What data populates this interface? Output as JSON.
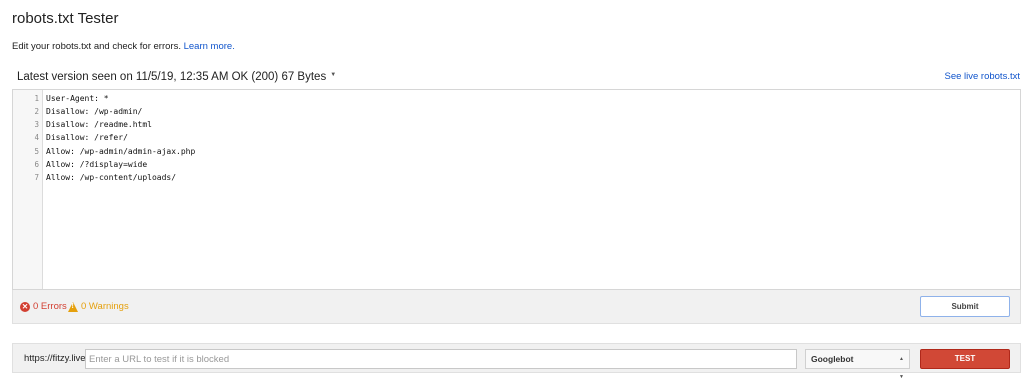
{
  "header": {
    "title": "robots.txt Tester",
    "description": "Edit your robots.txt and check for errors.",
    "learn_more": "Learn more."
  },
  "version": {
    "text": "Latest version seen on 11/5/19, 12:35 AM OK (200) 67 Bytes",
    "see_live": "See live robots.txt"
  },
  "editor": {
    "line_numbers": [
      "1",
      "2",
      "3",
      "4",
      "5",
      "6",
      "7"
    ],
    "lines": [
      "User-Agent: *",
      "Disallow: /wp-admin/",
      "Disallow: /readme.html",
      "Disallow: /refer/",
      "Allow: /wp-admin/admin-ajax.php",
      "Allow: /?display=wide",
      "Allow: /wp-content/uploads/"
    ]
  },
  "status": {
    "errors": "0 Errors",
    "warnings": "0 Warnings",
    "submit_label": "Submit"
  },
  "test": {
    "url_prefix": "https://fitzy.live/",
    "url_placeholder": "Enter a URL to test if it is blocked",
    "user_agent": "Googlebot",
    "test_label": "TEST"
  },
  "colors": {
    "link": "#1155cc",
    "error": "#d23f31",
    "warning": "#e5a00d",
    "test_button": "#d14836"
  }
}
